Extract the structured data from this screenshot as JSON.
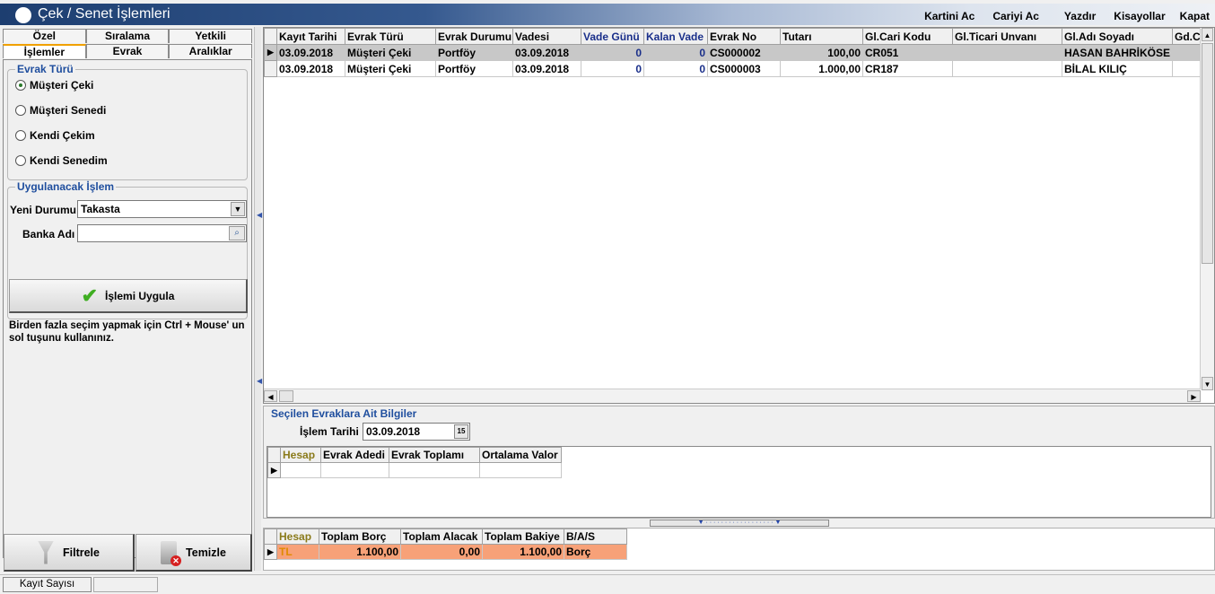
{
  "window": {
    "title": "Çek / Senet İşlemleri",
    "menu": [
      "Kartini Ac",
      "Cariyi Ac",
      "Yazdır",
      "Kisayollar",
      "Kapat"
    ]
  },
  "tabs": {
    "row1": [
      "Özel",
      "Sıralama",
      "Yetkili"
    ],
    "row2": [
      "İşlemler",
      "Evrak",
      "Aralıklar"
    ],
    "active": "İşlemler"
  },
  "evrak_turu": {
    "legend": "Evrak Türü",
    "options": [
      "Müşteri Çeki",
      "Müşteri Senedi",
      "Kendi Çekim",
      "Kendi Senedim"
    ],
    "selected": "Müşteri Çeki"
  },
  "uygulanacak": {
    "legend": "Uygulanacak İşlem",
    "yeni_durumu_label": "Yeni Durumu",
    "yeni_durumu_value": "Takasta",
    "banka_label": "Banka Adı",
    "banka_value": "",
    "apply_label": "İşlemi Uygula",
    "hint": "Birden fazla seçim yapmak için Ctrl + Mouse' un sol tuşunu kullanınız."
  },
  "buttons": {
    "filter": "Filtrele",
    "clear": "Temizle"
  },
  "grid": {
    "columns": [
      "Kayıt Tarihi",
      "Evrak Türü",
      "Evrak Durumu",
      "Vadesi",
      "Vade Günü",
      "Kalan Vade",
      "Evrak No",
      "Tutarı",
      "Gl.Cari Kodu",
      "Gl.Ticari Unvanı",
      "Gl.Adı Soyadı",
      "Gd.Ca"
    ],
    "rows": [
      [
        "03.09.2018",
        "Müşteri Çeki",
        "Portföy",
        "03.09.2018",
        "0",
        "0",
        "CS000002",
        "100,00",
        "CR051",
        "",
        "HASAN BAHRİKÖSE",
        ""
      ],
      [
        "03.09.2018",
        "Müşteri Çeki",
        "Portföy",
        "03.09.2018",
        "0",
        "0",
        "CS000003",
        "1.000,00",
        "CR187",
        "",
        "BİLAL KILIÇ",
        ""
      ]
    ]
  },
  "selected_info": {
    "legend": "Seçilen Evraklara Ait Bilgiler",
    "islem_tarihi_label": "İşlem Tarihi",
    "islem_tarihi_value": "03.09.2018",
    "columns": [
      "Hesap",
      "Evrak Adedi",
      "Evrak Toplamı",
      "Ortalama Valor"
    ]
  },
  "summary": {
    "columns": [
      "Hesap",
      "Toplam Borç",
      "Toplam Alacak",
      "Toplam Bakiye",
      "B/A/S"
    ],
    "row": [
      "TL",
      "1.100,00",
      "0,00",
      "1.100,00",
      "Borç"
    ]
  },
  "status": {
    "kayit_sayisi": "Kayıt Sayısı"
  },
  "colors": {
    "title_bar": "#1d3e70",
    "legend_blue": "#1f4e9e",
    "summary_row": "#f7a178",
    "tab_accent": "#f0a000"
  }
}
